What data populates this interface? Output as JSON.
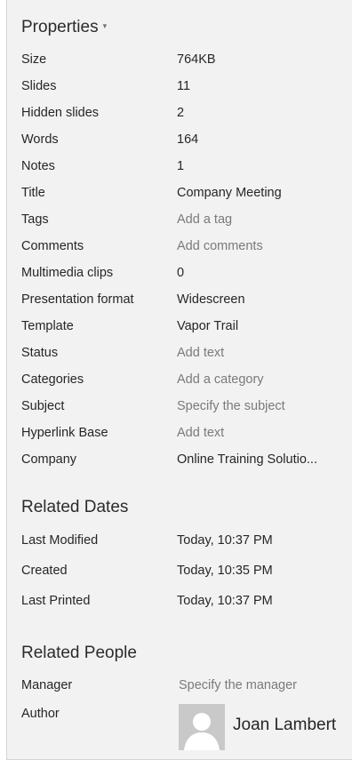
{
  "properties": {
    "title": "Properties",
    "caret": "▾",
    "rows": [
      {
        "label": "Size",
        "value": "764KB"
      },
      {
        "label": "Slides",
        "value": "11"
      },
      {
        "label": "Hidden slides",
        "value": "2"
      },
      {
        "label": "Words",
        "value": "164"
      },
      {
        "label": "Notes",
        "value": "1"
      },
      {
        "label": "Title",
        "value": "Company Meeting"
      },
      {
        "label": "Tags",
        "value": "Add a tag"
      },
      {
        "label": "Comments",
        "value": "Add comments"
      },
      {
        "label": "Multimedia clips",
        "value": "0"
      },
      {
        "label": "Presentation format",
        "value": "Widescreen"
      },
      {
        "label": "Template",
        "value": "Vapor Trail"
      },
      {
        "label": "Status",
        "value": "Add text"
      },
      {
        "label": "Categories",
        "value": "Add a category"
      },
      {
        "label": "Subject",
        "value": "Specify the subject"
      },
      {
        "label": "Hyperlink Base",
        "value": "Add text"
      },
      {
        "label": "Company",
        "value": "Online Training Solutio..."
      }
    ]
  },
  "related_dates": {
    "title": "Related Dates",
    "rows": [
      {
        "label": "Last Modified",
        "value": "Today, 10:37 PM"
      },
      {
        "label": "Created",
        "value": "Today, 10:35 PM"
      },
      {
        "label": "Last Printed",
        "value": "Today, 10:37 PM"
      }
    ]
  },
  "related_people": {
    "title": "Related People",
    "manager_label": "Manager",
    "manager_value": "Specify the manager",
    "author_label": "Author",
    "author_name": "Joan Lambert",
    "author_icon": "person-silhouette-icon"
  },
  "colors": {
    "panel_background": "#f2f2f2",
    "text": "#262626",
    "placeholder_text": "#7a7a7a",
    "avatar_background": "#c7c7c7"
  }
}
